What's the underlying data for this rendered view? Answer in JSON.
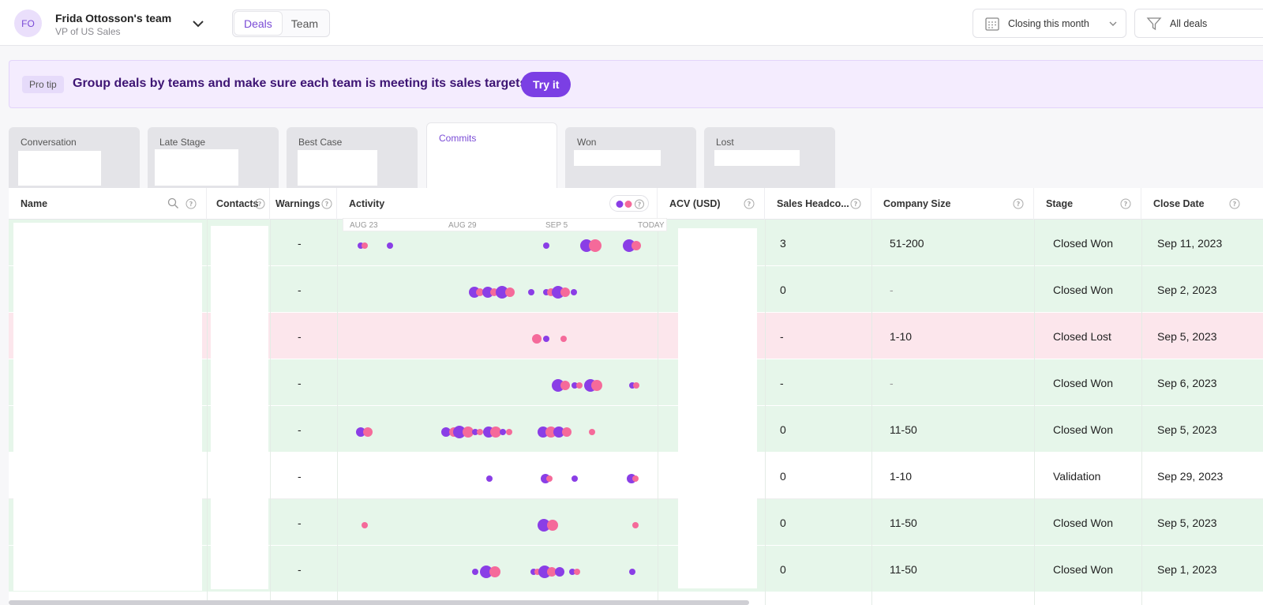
{
  "header": {
    "avatar_initials": "FO",
    "team_name": "Frida Ottosson's team",
    "team_role": "VP of US Sales",
    "tabs": [
      {
        "label": "Deals",
        "active": true
      },
      {
        "label": "Team",
        "active": false
      }
    ],
    "date_filter": "Closing this month",
    "deal_filter": "All deals"
  },
  "banner": {
    "badge": "Pro tip",
    "text": "Group deals by teams and make sure each team is meeting its sales targets",
    "button": "Try it"
  },
  "stage_tabs": [
    {
      "label": "Conversation"
    },
    {
      "label": "Late Stage"
    },
    {
      "label": "Best Case"
    },
    {
      "label": "Commits",
      "active": true
    },
    {
      "label": "Won"
    },
    {
      "label": "Lost"
    }
  ],
  "columns": {
    "name": "Name",
    "contacts": "Contacts",
    "warnings": "Warnings",
    "activity": "Activity",
    "acv": "ACV (USD)",
    "headcount": "Sales Headco...",
    "company_size": "Company Size",
    "stage": "Stage",
    "close_date": "Close Date"
  },
  "activity_axis": [
    "AUG 23",
    "AUG 29",
    "SEP 5",
    "TODAY"
  ],
  "colors": {
    "accent": "#7b3fe4",
    "dot_purple": "#8a3ee6",
    "dot_pink": "#f56a9a",
    "won_row": "#e6f6ea",
    "lost_row": "#fce6ec"
  },
  "rows": [
    {
      "status": "won",
      "warnings": "-",
      "headcount": "3",
      "company_size": "51-200",
      "stage": "Closed Won",
      "close_date": "Sep 11, 2023"
    },
    {
      "status": "won",
      "warnings": "-",
      "headcount": "0",
      "company_size": "-",
      "stage": "Closed Won",
      "close_date": "Sep 2, 2023"
    },
    {
      "status": "lost",
      "warnings": "-",
      "headcount": "-",
      "company_size": "1-10",
      "stage": "Closed Lost",
      "close_date": "Sep 5, 2023"
    },
    {
      "status": "won",
      "warnings": "-",
      "headcount": "-",
      "company_size": "-",
      "stage": "Closed Won",
      "close_date": "Sep 6, 2023"
    },
    {
      "status": "won",
      "warnings": "-",
      "headcount": "0",
      "company_size": "11-50",
      "stage": "Closed Won",
      "close_date": "Sep 5, 2023"
    },
    {
      "status": "open",
      "warnings": "-",
      "headcount": "0",
      "company_size": "1-10",
      "stage": "Validation",
      "close_date": "Sep 29, 2023"
    },
    {
      "status": "won",
      "warnings": "-",
      "headcount": "0",
      "company_size": "11-50",
      "stage": "Closed Won",
      "close_date": "Sep 5, 2023"
    },
    {
      "status": "won",
      "warnings": "-",
      "headcount": "0",
      "company_size": "11-50",
      "stage": "Closed Won",
      "close_date": "Sep 1, 2023"
    }
  ]
}
